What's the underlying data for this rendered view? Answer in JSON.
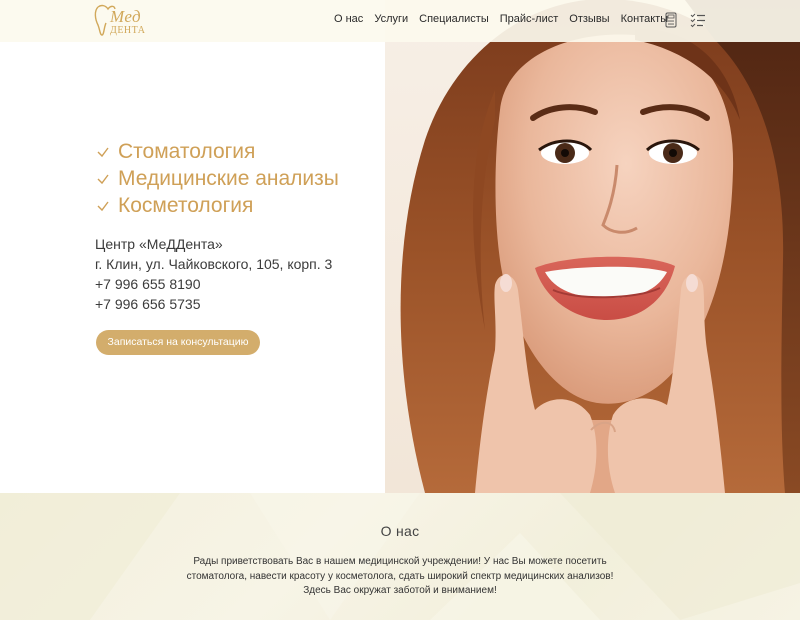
{
  "header": {
    "logo_word": "Мед",
    "logo_sub": "ДЕНТА",
    "nav": [
      "О нас",
      "Услуги",
      "Специалисты",
      "Прайс-лист",
      "Отзывы",
      "Контакты"
    ],
    "icons": [
      "calculator-icon",
      "checklist-icon"
    ]
  },
  "hero": {
    "services": [
      "Стоматология",
      "Медицинские анализы",
      "Косметология"
    ],
    "contacts": [
      "Центр «МеДДента»",
      "г. Клин, ул. Чайковского, 105, корп. 3",
      "+7 996 655 8190",
      "+7 996 656 5735"
    ],
    "cta_label": "Записаться на консультацию"
  },
  "about": {
    "title": "О нас",
    "lines": [
      "Рады приветствовать Вас в нашем медицинской учреждении! У нас Вы можете посетить",
      "стоматолога, навести красоту у косметолога, сдать широкий спектр медицинских анализов!",
      "Здесь Вас окружат заботой и вниманием!"
    ]
  },
  "colors": {
    "accent": "#cfa057",
    "button": "#d3ad6c",
    "header_bg": "#fcfaee",
    "about_bg": "#f4f1e0"
  }
}
